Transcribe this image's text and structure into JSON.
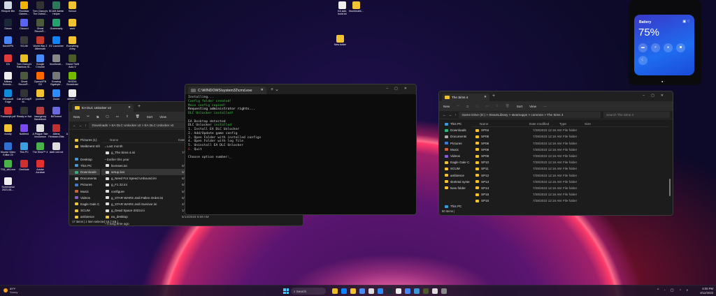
{
  "desktop": {
    "icons": [
      [
        "Recycle Bin",
        "Rockstar Games...",
        "Tom Clancy's The Divisio...",
        "SCUM Admin Helper",
        "School"
      ],
      [
        "Steam",
        "Discord",
        "Ghost Recon®...",
        "Grammarly",
        "work"
      ],
      [
        "NordVPN",
        "SCUM",
        "World War Z Aftermath",
        "EZ Launcher",
        "Everything Army"
      ],
      [
        "EA",
        "Tom Clancy's Rainbow Si...",
        "Google Chrome",
        "thumbnail...",
        "Grand Theft Auto V"
      ],
      [
        "Military Schedu...",
        "Ghost Recon®...",
        "OperaVPN GX",
        "Growing Gigabyte...",
        "NVIDIA Broadcast"
      ],
      [
        "Microsoft Edge",
        "Call of Duty® M...",
        "youtube",
        "Zoom",
        "sfl0067..."
      ],
      [
        "Transcript.pdf",
        "Ready or Not",
        "Insurgency Sandstorm",
        "BitTorrent",
        "Mo..."
      ],
      [
        "mostly",
        "Notifeed",
        "A Plague Tale Innocence",
        "Aliens Fireteam Elite",
        "A Plague..."
      ],
      [
        "Movavi Video Editor 23",
        "This PC",
        "The Sims™ 4",
        "sloth cert.txt",
        "Rea..."
      ],
      [
        "TS4_x64.exe",
        "OneNote",
        "Adobe Acrobat"
      ],
      [
        "Screenshot 2023-08-..."
      ]
    ],
    "icon_colors": [
      "#cfd8e3",
      "#f0b400",
      "#333",
      "#2a7a5a",
      "#f1c232",
      "#1b2838",
      "#5865f2",
      "#4a5a3a",
      "#21a36b",
      "#f1c232",
      "#4687ff",
      "#3a3a3a",
      "#c0392b",
      "#0a84ff",
      "#f1c232",
      "#e03a3a",
      "#e8c020",
      "#4a8af4",
      "#888",
      "#4a5a2a",
      "#eee",
      "#4a5a3a",
      "#ff6a00",
      "#777",
      "#76b900",
      "#0f8bd8",
      "#333",
      "#f1c232",
      "#2d8cff",
      "#eee",
      "#d03030",
      "#333",
      "#b04040",
      "#6a6ae0",
      "#666",
      "#f1c232",
      "#7a4af0",
      "#ddd",
      "#c03030",
      "#333",
      "#3070d0",
      "#3aa0e0",
      "#4ab04a",
      "#ddd",
      "#555",
      "#4ab04a",
      "#d03030",
      "#e03030",
      "#eee"
    ],
    "top_icons": [
      "EA add-build.txt",
      "thumbnails...",
      "New folder"
    ]
  },
  "terminal": {
    "tab": "C:\\WINDOWS\\system32\\cmd.exe",
    "lines": [
      [
        [
          "Installing...",
          "#d0d0d0"
        ]
      ],
      [
        [
          "Config folder created!",
          "#3cc83c"
        ]
      ],
      [
        [
          "Main config copied!",
          "#3cc83c"
        ]
      ],
      [
        [
          "Requesting administrator rights...",
          "#e8e8e8"
        ]
      ],
      [
        [
          "DLC Unlocker installed!",
          "#3cc83c"
        ]
      ],
      [
        [
          "",
          ""
        ]
      ],
      [
        [
          "EA Desktop detected",
          "#d0d0d0"
        ]
      ],
      [
        [
          "DLC Unlocker ",
          "#d0d0d0"
        ],
        [
          "installed",
          "#3cc83c"
        ]
      ],
      [
        [
          "1. Install EA DLC Unlocker",
          "#d0d0d0"
        ]
      ],
      [
        [
          "2. Add/Update game config",
          "#d0d0d0"
        ]
      ],
      [
        [
          "3. Open Folder with installed configs",
          "#d0d0d0"
        ]
      ],
      [
        [
          "4. Open Folder with log file",
          "#d0d0d0"
        ]
      ],
      [
        [
          "5. Uninstall EA DLC Unlocker",
          "#d0d0d0"
        ]
      ],
      [
        [
          "6.",
          "#e04040"
        ],
        [
          " Quit",
          "#d0d0d0"
        ]
      ],
      [
        [
          "",
          ""
        ]
      ],
      [
        [
          "Choose option number:",
          "#d0d0d0"
        ]
      ]
    ]
  },
  "explorer_left": {
    "tab": "EA DLC Unlocker v2",
    "toolbar": [
      "New",
      "Sort",
      "View"
    ],
    "path": "Downloads  >  EA DLC Unlocker v2  >  EA DLC Unlocker v2",
    "columns": [
      "Name",
      "Date modified"
    ],
    "sidebar": [
      [
        "Pictures (1)",
        0
      ],
      [
        "Walkment Info",
        0
      ],
      [
        "",
        0
      ],
      [
        "Desktop",
        0
      ],
      [
        "This PC",
        0
      ],
      [
        "Downloads",
        1
      ],
      [
        "Documents",
        0
      ],
      [
        "Pictures",
        0
      ],
      [
        "Music",
        0
      ],
      [
        "Videos",
        0
      ],
      [
        "Eagle Gale C...",
        0
      ],
      [
        "SCUM",
        0
      ],
      [
        "ambience",
        0
      ]
    ],
    "rows": [
      [
        "group",
        "Last month",
        ""
      ],
      [
        "file",
        "g_The Sims 4.ini",
        "7/16/2023 8:45 AM"
      ],
      [
        "group",
        "Earlier this year",
        ""
      ],
      [
        "file",
        "licenses.txt",
        "6/20/2023 6:08 AM"
      ],
      [
        "sel",
        "setup.bat",
        "6/20/2023 6:08 AM"
      ],
      [
        "file",
        "g_Need For Speed Unbound.ini",
        "6/20/2023 3:56 AM"
      ],
      [
        "file",
        "g_F1 22.ini",
        "6/14/2023 6:01 AM"
      ],
      [
        "file",
        "configure",
        "6/14/2023 1:27 AM"
      ],
      [
        "file",
        "g_STAR WARS Jedi Fallen Order.ini",
        "6/11/2023 2:24 AM"
      ],
      [
        "file",
        "g_STAR WARS Jedi Survivor.ini",
        "4/28/2023 7:58 AM"
      ],
      [
        "file",
        "g_Dead Space 2023.ini",
        "1/30/2023 2:24 AM"
      ],
      [
        "folder",
        "ea_desktop",
        "6/14/2023 5:59 AM"
      ],
      [
        "group",
        "A long time ago",
        ""
      ]
    ],
    "status": "17 items  |  1 item selected  15.7 KB  |"
  },
  "explorer_right": {
    "tab": "The Sims 4",
    "toolbar": [
      "New",
      "Sort",
      "View",
      "···"
    ],
    "path": "Game Drive (D:)  >  SteamLibrary  >  steamapps  >  common  >  The Sims 4",
    "search_placeholder": "Search The Sims 4",
    "columns": [
      "Name",
      "Date modified",
      "Type",
      "Size"
    ],
    "sidebar": [
      "This PC",
      "Downloads",
      "Documents",
      "Pictures",
      "Music",
      "Videos",
      "Eagle Gale C...",
      "SCUM",
      "ambience",
      "skeletal system",
      "New folder"
    ],
    "sidebar_bottom": "This PC",
    "rows": [
      "SP04",
      "SP05",
      "SP06",
      "SP08",
      "SP09",
      "SP10",
      "SP11",
      "SP12",
      "SP13",
      "SP14",
      "SP15",
      "SP16"
    ],
    "date": "7/28/2023 12:16 AM",
    "type": "File folder",
    "status": "50 items  |"
  },
  "battery": {
    "title": "Battery",
    "percent": "75%",
    "level": 75
  },
  "taskbar": {
    "weather_temp": "89°F",
    "weather_desc": "Sunny",
    "search": "Search",
    "time": "6:08 PM",
    "date": "8/12/2023",
    "app_colors": [
      "#e8c020",
      "#0a84ff",
      "#f1c232",
      "#4a8af4",
      "#ddd",
      "#2d8cff",
      "#1b2838",
      "#eee",
      "#4687ff",
      "#3a9ad9",
      "#4a5a2a",
      "#ddd",
      "#888"
    ]
  }
}
